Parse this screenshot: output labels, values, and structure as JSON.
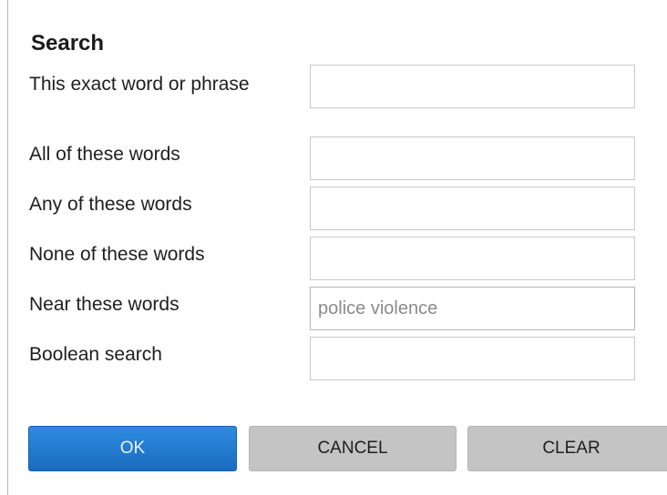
{
  "dialog": {
    "title": "Search"
  },
  "fields": [
    {
      "label": "This exact word or phrase",
      "value": ""
    },
    {
      "label": "All of these words",
      "value": ""
    },
    {
      "label": "Any of these words",
      "value": ""
    },
    {
      "label": "None of these words",
      "value": ""
    },
    {
      "label": "Near these words",
      "value": "police violence"
    },
    {
      "label": "Boolean search",
      "value": ""
    }
  ],
  "buttons": {
    "ok": "OK",
    "cancel": "CANCEL",
    "clear": "CLEAR"
  },
  "colors": {
    "ok_button": "#1a6cc0",
    "secondary_button": "#c4c4c4",
    "input_border": "#c9c9c9"
  }
}
